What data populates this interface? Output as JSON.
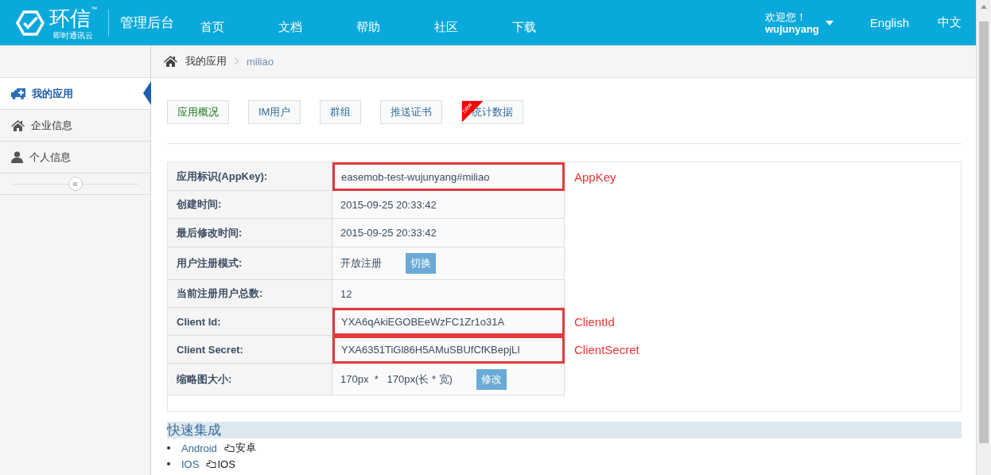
{
  "header": {
    "logo": {
      "name": "环信",
      "tagline": "即时通讯云",
      "trademark": "™"
    },
    "title": "管理后台",
    "nav": [
      {
        "label": "首页"
      },
      {
        "label": "文档"
      },
      {
        "label": "帮助"
      },
      {
        "label": "社区"
      },
      {
        "label": "下载"
      }
    ],
    "user": {
      "greeting": "欢迎您！",
      "name": "wujunyang"
    },
    "languages": [
      {
        "label": "English"
      },
      {
        "label": "中文"
      }
    ]
  },
  "sidebar": {
    "items": [
      {
        "label": "我的应用",
        "selected": true
      },
      {
        "label": "企业信息",
        "selected": false
      },
      {
        "label": "个人信息",
        "selected": false
      }
    ],
    "collapse": "«"
  },
  "breadcrumb": [
    "我的应用",
    "miliao"
  ],
  "tabs": [
    {
      "label": "应用概况",
      "selected": true
    },
    {
      "label": "IM用户",
      "selected": false
    },
    {
      "label": "群组",
      "selected": false
    },
    {
      "label": "推送证书",
      "selected": false
    },
    {
      "label": "统计数据",
      "selected": false,
      "badge": "new"
    }
  ],
  "details": [
    {
      "label": "应用标识(AppKey):",
      "value": "easemob-test-wujunyang#miliao",
      "highlighted": true,
      "annotation": "AppKey"
    },
    {
      "label": "创建时间:",
      "value": "2015-09-25 20:33:42",
      "highlighted": false
    },
    {
      "label": "最后修改时间:",
      "value": "2015-09-25 20:33:42",
      "highlighted": false
    },
    {
      "label": "用户注册模式:",
      "value": "开放注册",
      "action": "切换",
      "highlighted": false
    },
    {
      "label": "当前注册用户总数:",
      "value": "12",
      "highlighted": false
    },
    {
      "label": "Client Id:",
      "value": "YXA6qAkiEGOBEeWzFC1Zr1o31A",
      "highlighted": true,
      "annotation": "ClientId"
    },
    {
      "label": "Client Secret:",
      "value": "YXA6351TiGl86H5AMuSBUfCfKBepjLI",
      "highlighted": true,
      "annotation": "ClientSecret"
    },
    {
      "label": "缩略图大小:",
      "value": "170px  *   170px(长 * 宽)",
      "action": "修改",
      "highlighted": false
    }
  ],
  "quick_start": {
    "title": "快速集成",
    "links": [
      {
        "link": "Android",
        "text": "安卓"
      },
      {
        "link": "IOS",
        "text": "IOS"
      }
    ]
  }
}
